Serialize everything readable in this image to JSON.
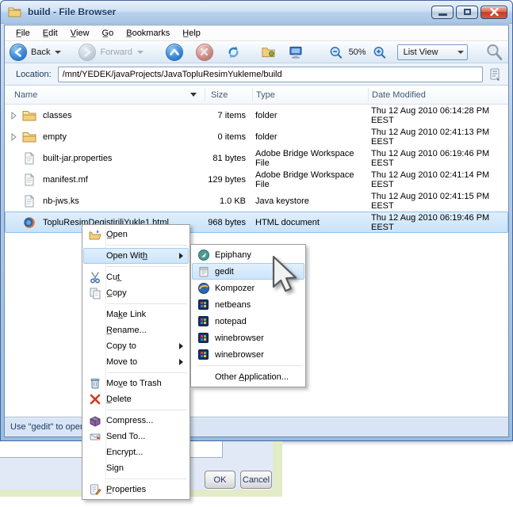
{
  "window": {
    "title": "build - File Browser"
  },
  "menubar": {
    "items": [
      "F̲ile",
      "E̲dit",
      "V̲iew",
      "G̲o",
      "B̲ookmarks",
      "H̲elp"
    ]
  },
  "toolbar": {
    "back_label": "Back",
    "forward_label": "Forward",
    "zoom_level": "50%",
    "view_mode": "List View",
    "icons": [
      "back-icon",
      "forward-icon",
      "up-icon",
      "stop-icon",
      "reload-icon",
      "home-folder-icon",
      "computer-icon",
      "zoom-out-icon",
      "zoom-in-icon",
      "search-icon"
    ]
  },
  "location": {
    "label": "Location:",
    "value": "/mnt/YEDEK/javaProjects/JavaTopluResimYukleme/build"
  },
  "filelist": {
    "columns": {
      "name": "Name",
      "size": "Size",
      "type": "Type",
      "date": "Date Modified"
    },
    "rows": [
      {
        "name": "classes",
        "size": "7 items",
        "type": "folder",
        "date": "Thu 12 Aug 2010 06:14:28 PM EEST",
        "icon": "folder-icon",
        "expander": true
      },
      {
        "name": "empty",
        "size": "0 items",
        "type": "folder",
        "date": "Thu 12 Aug 2010 02:41:13 PM EEST",
        "icon": "folder-icon",
        "expander": true
      },
      {
        "name": "built-jar.properties",
        "size": "81 bytes",
        "type": "Adobe Bridge Workspace File",
        "date": "Thu 12 Aug 2010 06:19:46 PM EEST",
        "icon": "text-file-icon",
        "expander": false
      },
      {
        "name": "manifest.mf",
        "size": "129 bytes",
        "type": "Adobe Bridge Workspace File",
        "date": "Thu 12 Aug 2010 02:41:14 PM EEST",
        "icon": "text-file-icon",
        "expander": false
      },
      {
        "name": "nb-jws.ks",
        "size": "1.0 KB",
        "type": "Java keystore",
        "date": "Thu 12 Aug 2010 02:41:15 PM EEST",
        "icon": "text-file-icon",
        "expander": false
      },
      {
        "name": "TopluResimDegistiriliYukle1.html",
        "size": "968 bytes",
        "type": "HTML document",
        "date": "Thu 12 Aug 2010 06:19:46 PM EEST",
        "icon": "firefox-icon",
        "expander": false,
        "selected": true
      }
    ]
  },
  "context_menu": {
    "items": [
      {
        "label": "O̲pen",
        "icon": "folder-open-icon"
      },
      {
        "label": "Open With̲",
        "submenu": true,
        "highlighted": true
      },
      {
        "label": "Cut̲",
        "icon": "scissors-icon"
      },
      {
        "label": "C̲opy",
        "icon": "copy-icon"
      },
      {
        "label": "Mak̲e Link"
      },
      {
        "label": "R̲ename..."
      },
      {
        "label": "Copy to",
        "submenu": true
      },
      {
        "label": "Move to",
        "submenu": true
      },
      {
        "label": "Mov̲e to Trash",
        "icon": "trash-icon"
      },
      {
        "label": "D̲elete",
        "icon": "delete-x-icon"
      },
      {
        "label": "Compress...",
        "icon": "archive-icon"
      },
      {
        "label": "Send To...",
        "icon": "envelope-icon"
      },
      {
        "label": "Encrypt..."
      },
      {
        "label": "Sign"
      },
      {
        "label": "P̲roperties",
        "icon": "properties-icon"
      }
    ]
  },
  "open_with_submenu": {
    "items": [
      {
        "label": "Epiphany",
        "icon": "epiphany-globe-icon"
      },
      {
        "label": "gedit",
        "icon": "gedit-notepad-icon",
        "highlighted": true
      },
      {
        "label": "Kompozer",
        "icon": "kompozer-globe-icon"
      },
      {
        "label": "netbeans",
        "icon": "windows-app-icon"
      },
      {
        "label": "notepad",
        "icon": "windows-app-icon"
      },
      {
        "label": "winebrowser",
        "icon": "windows-app-icon"
      },
      {
        "label": "winebrowser",
        "icon": "windows-app-icon"
      },
      {
        "label": "Other A̲pplication..."
      }
    ]
  },
  "statusbar": {
    "text": "Use \"gedit\" to open"
  },
  "background_dialog": {
    "ok_label": "OK",
    "cancel_label": "Cancel"
  },
  "colors": {
    "titlebar_text": "#1e3a68",
    "selection": "#cde3f9",
    "menu_highlight": "#d2e7fb",
    "close_button_red": "#c23b26",
    "status_bg": "#d9e5f4",
    "dialog_green": "#e2ecc6"
  }
}
